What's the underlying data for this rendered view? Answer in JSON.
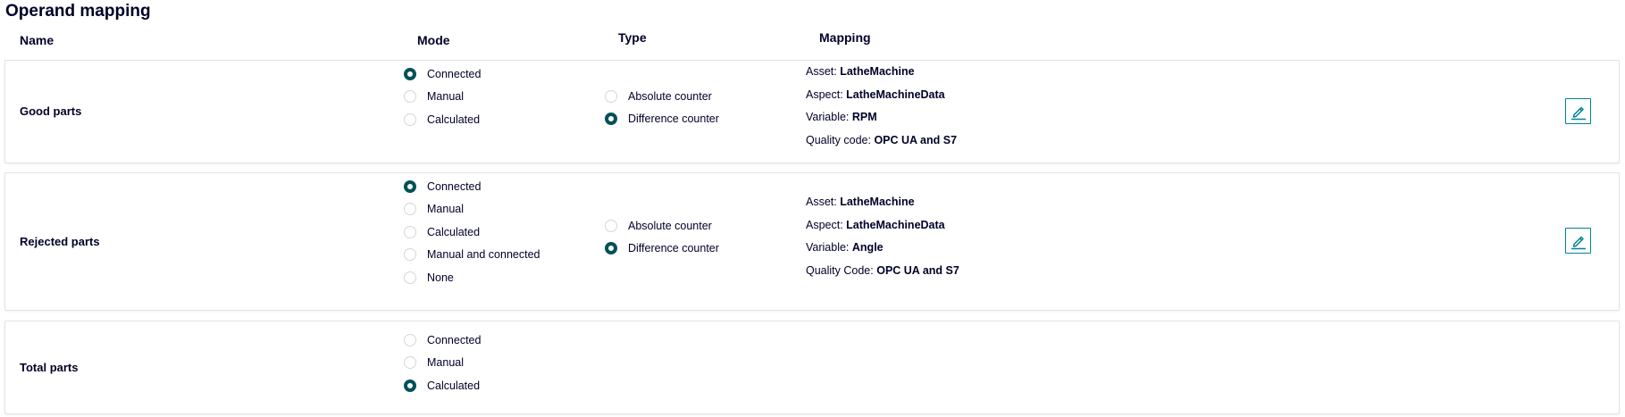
{
  "page": {
    "title": "Operand mapping"
  },
  "columns": {
    "name": "Name",
    "mode": "Mode",
    "type": "Type",
    "mapping": "Mapping"
  },
  "rows": [
    {
      "name": "Good parts",
      "modes": [
        {
          "label": "Connected",
          "checked": true
        },
        {
          "label": "Manual",
          "checked": false
        },
        {
          "label": "Calculated",
          "checked": false
        }
      ],
      "types": [
        {
          "label": "Absolute counter",
          "checked": false
        },
        {
          "label": "Difference counter",
          "checked": true
        }
      ],
      "mapping": [
        {
          "key": "Asset: ",
          "value": "LatheMachine"
        },
        {
          "key": "Aspect: ",
          "value": "LatheMachineData"
        },
        {
          "key": "Variable: ",
          "value": "RPM"
        },
        {
          "key": "Quality code: ",
          "value": "OPC UA and S7"
        }
      ],
      "edit_icon": "pencil-icon"
    },
    {
      "name": "Rejected parts",
      "modes": [
        {
          "label": "Connected",
          "checked": true
        },
        {
          "label": "Manual",
          "checked": false
        },
        {
          "label": "Calculated",
          "checked": false
        },
        {
          "label": "Manual and connected",
          "checked": false
        },
        {
          "label": "None",
          "checked": false
        }
      ],
      "types": [
        {
          "label": "Absolute counter",
          "checked": false
        },
        {
          "label": "Difference counter",
          "checked": true
        }
      ],
      "mapping": [
        {
          "key": "Asset: ",
          "value": "LatheMachine"
        },
        {
          "key": "Aspect: ",
          "value": "LatheMachineData"
        },
        {
          "key": "Variable: ",
          "value": "Angle"
        },
        {
          "key": "Quality Code: ",
          "value": "OPC UA and S7"
        }
      ],
      "edit_icon": "pencil-icon"
    },
    {
      "name": "Total parts",
      "modes": [
        {
          "label": "Connected",
          "checked": false
        },
        {
          "label": "Manual",
          "checked": false
        },
        {
          "label": "Calculated",
          "checked": true
        }
      ]
    }
  ],
  "colors": {
    "accent": "#005159",
    "button_border": "#00858f",
    "text": "#000028",
    "card_border": "#e0e3e6"
  }
}
